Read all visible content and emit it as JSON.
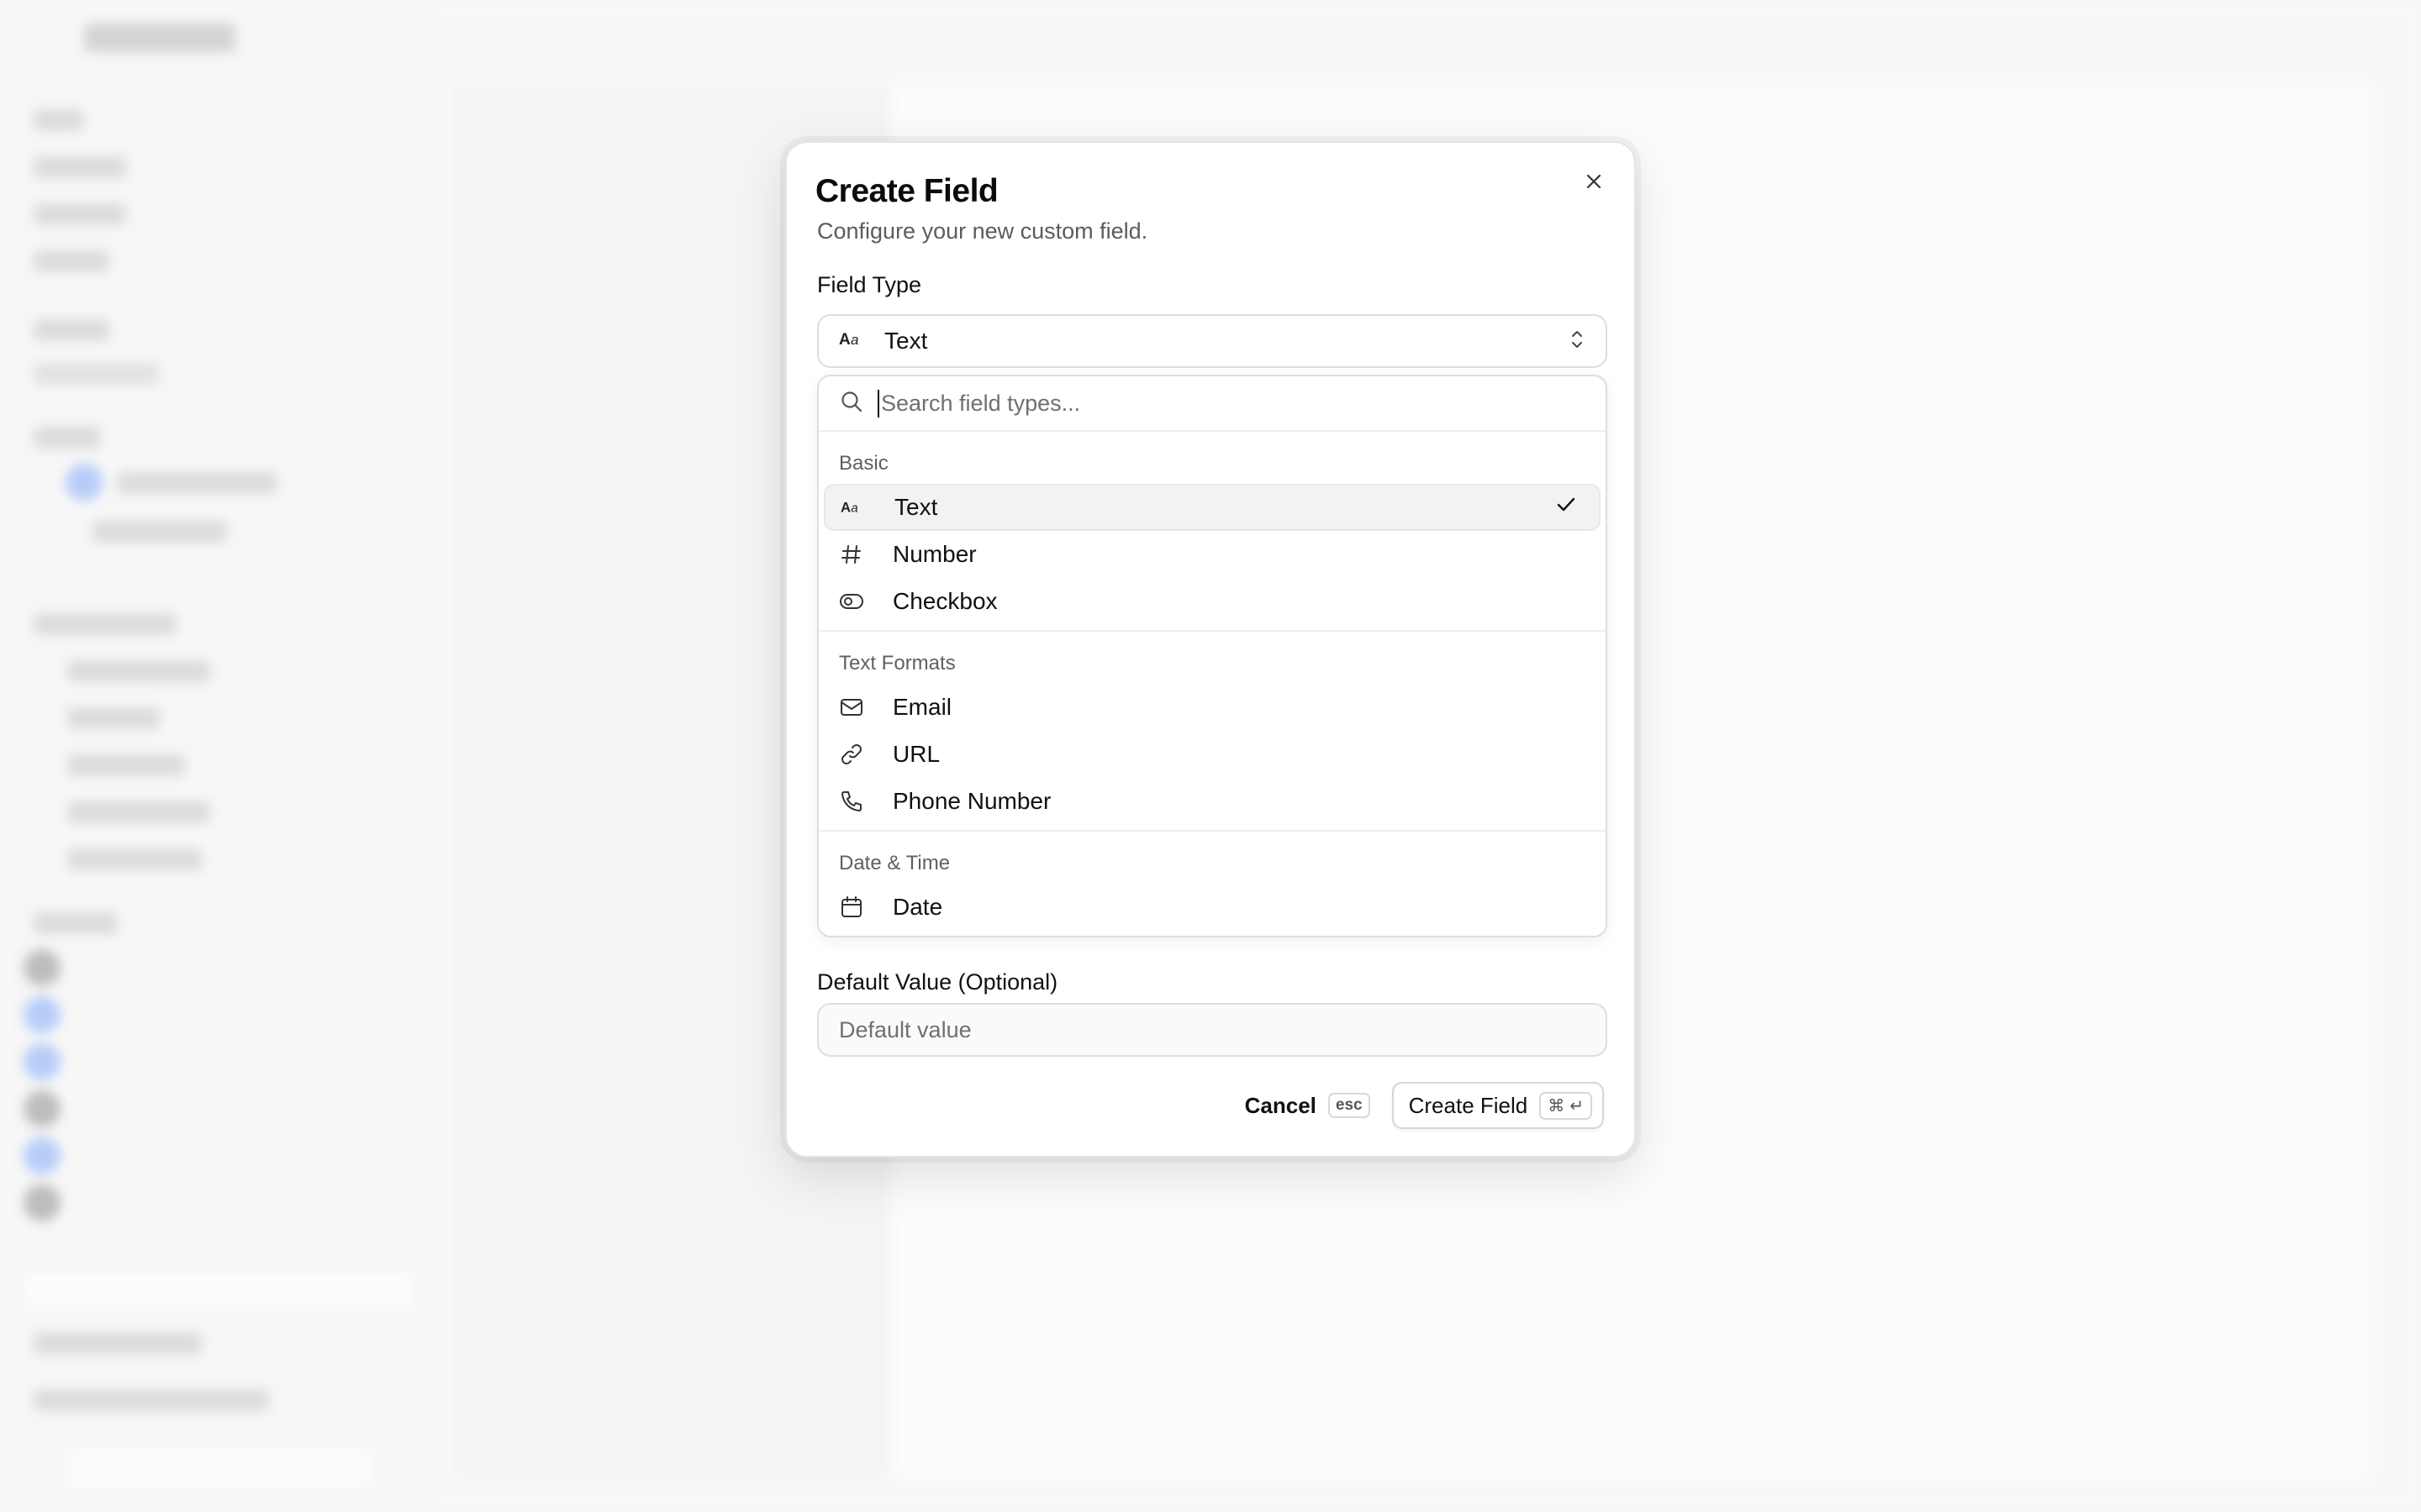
{
  "dialog": {
    "title": "Create Field",
    "subtitle": "Configure your new custom field.",
    "close_icon": "x-icon"
  },
  "field_type": {
    "label": "Field Type",
    "selected_value": "Text",
    "selected_icon": "text-type-icon"
  },
  "dropdown": {
    "search_placeholder": "Search field types...",
    "groups": [
      {
        "label": "Basic",
        "options": [
          {
            "label": "Text",
            "icon": "text-type-icon",
            "selected": true
          },
          {
            "label": "Number",
            "icon": "hash-icon",
            "selected": false
          },
          {
            "label": "Checkbox",
            "icon": "toggle-icon",
            "selected": false
          }
        ]
      },
      {
        "label": "Text Formats",
        "options": [
          {
            "label": "Email",
            "icon": "mail-icon",
            "selected": false
          },
          {
            "label": "URL",
            "icon": "link-icon",
            "selected": false
          },
          {
            "label": "Phone Number",
            "icon": "phone-icon",
            "selected": false
          }
        ]
      },
      {
        "label": "Date & Time",
        "options": [
          {
            "label": "Date",
            "icon": "calendar-icon",
            "selected": false
          }
        ]
      }
    ]
  },
  "default_value": {
    "label": "Default Value (Optional)",
    "placeholder": "Default value",
    "value": ""
  },
  "footer": {
    "cancel_label": "Cancel",
    "cancel_shortcut": "esc",
    "create_label": "Create Field",
    "create_shortcut_cmd": "⌘",
    "create_shortcut_enter": "↵"
  },
  "colors": {
    "dialog_bg": "#ffffff",
    "border": "#dedede",
    "selected_option_bg": "#f2f2f2",
    "muted_text": "#5c5c5c"
  }
}
